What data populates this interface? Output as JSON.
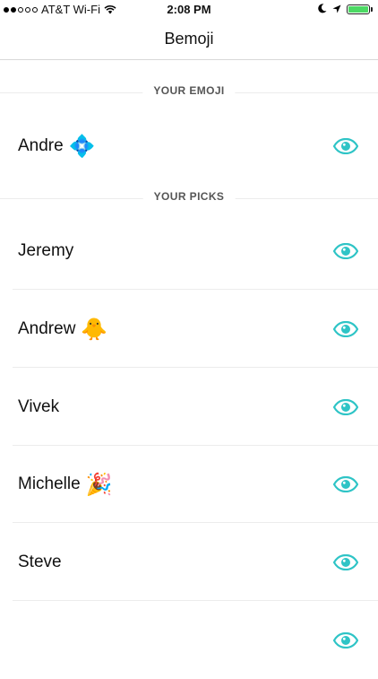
{
  "status_bar": {
    "carrier": "AT&T Wi-Fi",
    "time": "2:08 PM",
    "signal_bars_filled": 2,
    "signal_bars_total": 5,
    "battery_level": 1.0,
    "icons": [
      "wifi-icon",
      "moon-icon",
      "location-arrow-icon",
      "battery-icon"
    ]
  },
  "nav": {
    "title": "Bemoji"
  },
  "sections": {
    "your_emoji": {
      "label": "YOUR EMOJI"
    },
    "your_picks": {
      "label": "YOUR PICKS"
    }
  },
  "your_emoji_row": {
    "name": "Andre",
    "emoji": "💠"
  },
  "picks": [
    {
      "name": "Jeremy",
      "emoji": ""
    },
    {
      "name": "Andrew",
      "emoji": "🐥"
    },
    {
      "name": "Vivek",
      "emoji": ""
    },
    {
      "name": "Michelle",
      "emoji": "🎉"
    },
    {
      "name": "Steve",
      "emoji": ""
    },
    {
      "name": "",
      "emoji": ""
    }
  ],
  "colors": {
    "accent": "#2ec4c6",
    "battery": "#4cd964",
    "divider": "#ececec",
    "section_label": "#555555"
  },
  "row_icon": "eye-icon"
}
